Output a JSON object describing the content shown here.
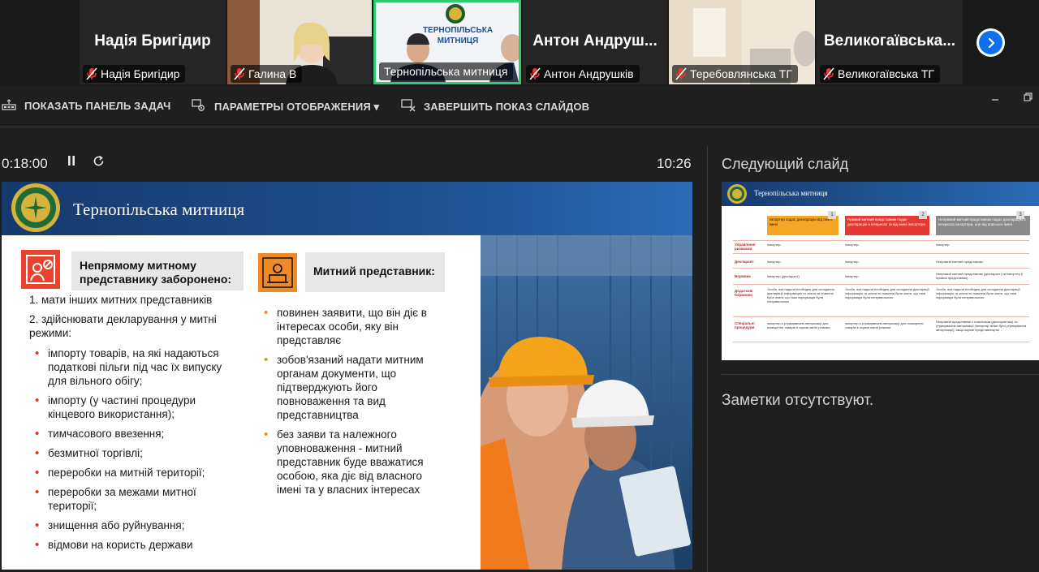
{
  "participants": [
    {
      "big_name": "Надія Бригідир",
      "label": "Надія Бригідир",
      "muted": true,
      "video": false
    },
    {
      "big_name": "",
      "label": "Галина В",
      "muted": true,
      "video": true
    },
    {
      "big_name": "",
      "label": "Тернопільська митниця",
      "muted": false,
      "video": true,
      "active": true,
      "banner": "ТЕРНОПІЛЬСЬКА МИТНИЦЯ"
    },
    {
      "big_name": "Антон  Андруш...",
      "label": "Антон Андрушків",
      "muted": true,
      "video": false
    },
    {
      "big_name": "",
      "label": "Теребовлянська ТГ",
      "muted": true,
      "video": true
    },
    {
      "big_name": "Великогаївська...",
      "label": "Великогаївська ТГ",
      "muted": true,
      "video": false
    }
  ],
  "toolbar": {
    "show_taskbar": "ПОКАЗАТЬ ПАНЕЛЬ ЗАДАЧ",
    "display_settings": "ПАРАМЕТРЫ ОТОБРАЖЕНИЯ ▾",
    "end_slideshow": "ЗАВЕРШИТЬ ПОКАЗ СЛАЙДОВ"
  },
  "presenter": {
    "elapsed": "0:18:00",
    "clock": "10:26",
    "next_slide_title": "Следующий слайд",
    "notes_text": "Заметки отсутствуют."
  },
  "slide": {
    "title": "Тернопільська митниця",
    "left_heading": "Непрямому митному представнику заборонено:",
    "left_items": [
      "1.  мати інших митних представників",
      "2.  здійснювати декларування у митні режими:"
    ],
    "left_subitems": [
      "імпорту товарів, на які надаються податкові пільги під час їх випуску для вільного обігу;",
      "імпорту (у частині процедури кінцевого використання);",
      "тимчасового ввезення;",
      "безмитної торгівлі;",
      "переробки на митній території;",
      "переробки за межами митної території;",
      "знищення або руйнування;",
      "відмови на користь держави"
    ],
    "right_heading": "Митний представник:",
    "right_items": [
      "повинен заявити, що він діє в інтересах особи, яку він представляє",
      "зобов'язаний надати митним органам документи, що підтверджують його повноваження та вид представництва",
      "без заяви та належного уповноваження - митний представник буде вважатися особою, яка діє від власного імені та у власних інтересах"
    ]
  },
  "next_slide": {
    "title": "Тернопільська митниця",
    "columns": [
      {
        "text": "Імпортер подає декларацію від свого імені",
        "num": "1",
        "color": "#f5a623"
      },
      {
        "text": "Прямий митний представник подає декларацію в інтересах та від імені імпортера",
        "num": "2",
        "color": "#e53935"
      },
      {
        "text": "Непрямий митний представник подає декларацію в інтересах імпортера, але від власного імені",
        "num": "3",
        "color": "#8a8a8a"
      }
    ],
    "rows": [
      {
        "label": "Управління ризиками",
        "cells": [
          "Імпортер",
          "Імпортер",
          "Імпортер"
        ]
      },
      {
        "label": "Декларант",
        "cells": [
          "Імпортер",
          "Імпортер",
          "Непрямий митний представник"
        ]
      },
      {
        "label": "Боржник",
        "cells": [
          "Імпортер (декларант)",
          "Імпортер",
          "Непрямий митний представник (декларант) та Імпортер (і прямий представник)"
        ]
      },
      {
        "label": "Додаткові боржники",
        "cells": [
          "Особа, яка надала необхідну для складання декларації інформацію та знала чи повинна була знати, що така інформація була неправильною",
          "Особа, яка надала необхідну для складання декларації інформацію та знала чи повинна була знати, що така інформація була неправильною",
          "Особа, яка надала необхідну для складання декларації інформацію та знала чи повинна була знати, що така інформація була неправильною"
        ]
      },
      {
        "label": "Спеціальні процедури",
        "cells": [
          "Імпортер є утримувачем авторизації для поміщення товарів в окремі митні режими",
          "Імпортер є утримувачем авторизації для поміщення товарів в окремі митні режими",
          "Непрямий представник є власником (декларантом) та утримувачем авторизації (імпортер може бути утримувачем авторизації), якщо окремі представництво"
        ]
      }
    ]
  }
}
